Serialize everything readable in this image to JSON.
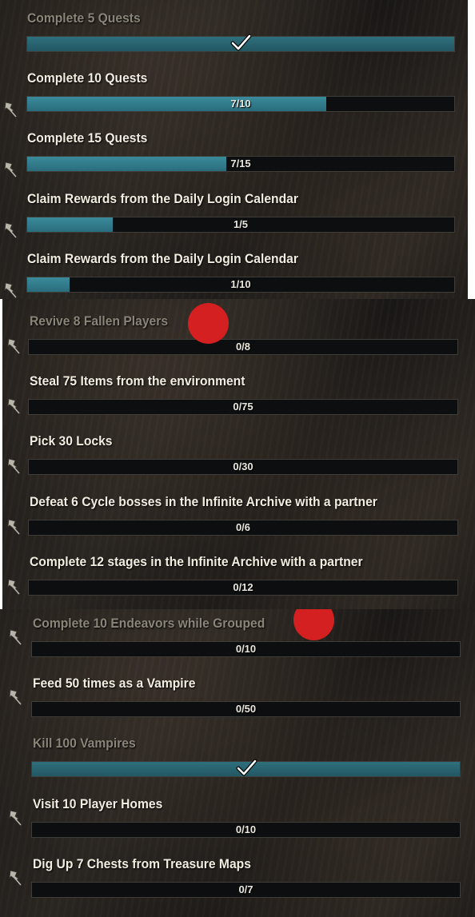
{
  "panels": [
    {
      "quests": [
        {
          "title": "Complete 5 Quests",
          "progress_text": "",
          "progress": 1.0,
          "completed": true,
          "pinned": false
        },
        {
          "title": "Complete 10 Quests",
          "progress_text": "7/10",
          "progress": 0.7,
          "completed": false,
          "pinned": true
        },
        {
          "title": "Complete 15 Quests",
          "progress_text": "7/15",
          "progress": 0.467,
          "completed": false,
          "pinned": true
        },
        {
          "title": "Claim Rewards from the Daily Login Calendar",
          "progress_text": "1/5",
          "progress": 0.2,
          "completed": false,
          "pinned": true
        },
        {
          "title": "Claim Rewards from the Daily Login Calendar",
          "progress_text": "1/10",
          "progress": 0.1,
          "completed": false,
          "pinned": true
        }
      ]
    },
    {
      "quests": [
        {
          "title": "Revive 8 Fallen Players",
          "progress_text": "0/8",
          "progress": 0.0,
          "completed": false,
          "pinned": true,
          "dim": true,
          "marked": true
        },
        {
          "title": "Steal 75 Items from the environment",
          "progress_text": "0/75",
          "progress": 0.0,
          "completed": false,
          "pinned": true
        },
        {
          "title": "Pick 30 Locks",
          "progress_text": "0/30",
          "progress": 0.0,
          "completed": false,
          "pinned": true
        },
        {
          "title": "Defeat 6 Cycle bosses in the Infinite Archive with a partner",
          "progress_text": "0/6",
          "progress": 0.0,
          "completed": false,
          "pinned": true
        },
        {
          "title": "Complete 12 stages in the Infinite Archive with a partner",
          "progress_text": "0/12",
          "progress": 0.0,
          "completed": false,
          "pinned": true
        }
      ]
    },
    {
      "quests": [
        {
          "title": "Complete 10 Endeavors while Grouped",
          "progress_text": "0/10",
          "progress": 0.0,
          "completed": false,
          "pinned": true,
          "dim": true,
          "marked": true
        },
        {
          "title": "Feed 50 times as a Vampire",
          "progress_text": "0/50",
          "progress": 0.0,
          "completed": false,
          "pinned": true
        },
        {
          "title": "Kill 100 Vampires",
          "progress_text": "",
          "progress": 1.0,
          "completed": true,
          "pinned": false
        },
        {
          "title": "Visit 10 Player Homes",
          "progress_text": "0/10",
          "progress": 0.0,
          "completed": false,
          "pinned": true
        },
        {
          "title": "Dig Up 7 Chests from Treasure Maps",
          "progress_text": "0/7",
          "progress": 0.0,
          "completed": false,
          "pinned": true
        }
      ]
    }
  ],
  "icons": {
    "pin": "pushpin-icon",
    "check": "checkmark-icon",
    "marker": "red-circle-marker"
  },
  "colors": {
    "bar_fill": "#3a8a9a",
    "marker": "#d42020",
    "title": "#f2ede0",
    "dim_title": "#8a8578"
  }
}
